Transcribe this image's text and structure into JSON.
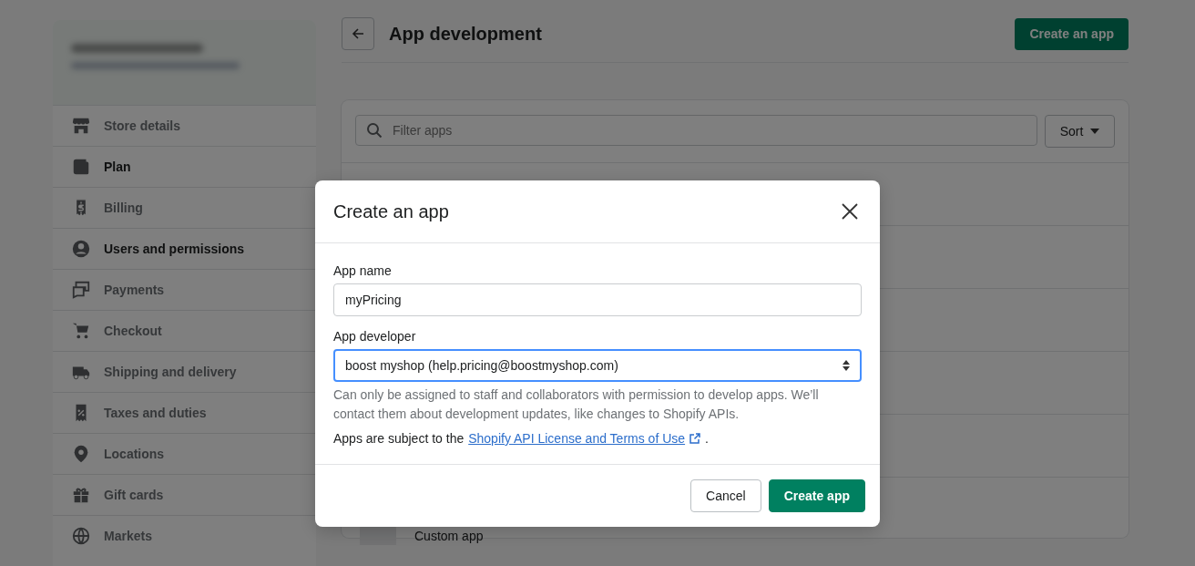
{
  "sidebar": {
    "items": [
      {
        "label": "Store details",
        "active": false
      },
      {
        "label": "Plan",
        "active": true
      },
      {
        "label": "Billing",
        "active": false
      },
      {
        "label": "Users and permissions",
        "active": true
      },
      {
        "label": "Payments",
        "active": false
      },
      {
        "label": "Checkout",
        "active": false
      },
      {
        "label": "Shipping and delivery",
        "active": false
      },
      {
        "label": "Taxes and duties",
        "active": false
      },
      {
        "label": "Locations",
        "active": false
      },
      {
        "label": "Gift cards",
        "active": false
      },
      {
        "label": "Markets",
        "active": false
      }
    ]
  },
  "page": {
    "title": "App development",
    "primary_button": "Create an app",
    "filter": {
      "placeholder": "Filter apps"
    },
    "sort_button": "Sort",
    "rows": [
      {
        "label": "Custom app"
      }
    ]
  },
  "modal": {
    "title": "Create an app",
    "fields": [
      {
        "kind": "text",
        "label": "App name",
        "value": "myPricing",
        "focused": false
      },
      {
        "kind": "select",
        "label": "App developer",
        "value": "boost myshop (help.pricing@boostmyshop.com)",
        "focused": true
      }
    ],
    "help_text": "Can only be assigned to staff and collaborators with permission to develop apps. We’ll contact them about development updates, like changes to Shopify APIs.",
    "terms": {
      "before": "Apps are subject to the",
      "link": "Shopify API License and Terms of Use",
      "after": "."
    },
    "buttons": [
      {
        "kind": "secondary",
        "label": "Cancel"
      },
      {
        "kind": "primary",
        "label": "Create app"
      }
    ]
  }
}
